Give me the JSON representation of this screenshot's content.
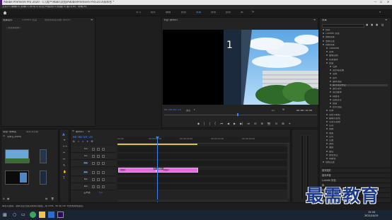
{
  "titlebar": {
    "title": "Adobe Premiere Pro 2020 - C:\\用户\\9bbs\\文档\\Adobe\\Premiere Pro\\14.0\\未命名 *",
    "min": "—",
    "max": "☐",
    "close": "✕"
  },
  "menus": [
    "文件(F)",
    "编辑(E)",
    "剪辑(C)",
    "序列(S)",
    "标记(M)",
    "图形(G)",
    "视图(V)",
    "窗口(W)",
    "帮助(H)"
  ],
  "workspaces": [
    "学习",
    "组件",
    "编辑",
    "颜色",
    "效果",
    "音频",
    "图形",
    "库"
  ],
  "active_workspace": "效果",
  "effect_controls": {
    "tabs": [
      "效果控件",
      "Lumetri 范围",
      "音频剪辑混合器: 序列01"
    ],
    "subtitle": "（ 未选择剪辑 ）"
  },
  "program": {
    "title": "节目: 序列01",
    "timecode_current": "00:00:04:24",
    "fit": "适合",
    "ratio": "1/2",
    "timecode_total": "00:00:10:00",
    "video_overlay_digit": "1",
    "transport": [
      "◆",
      "|",
      "|",
      "{",
      "⏮",
      "◀",
      "▶",
      "▶|",
      "⏭",
      "⊟",
      "⊞",
      "📷",
      "⊡",
      "⊠",
      "+"
    ]
  },
  "effects": {
    "tab": "效果",
    "items": [
      {
        "label": "预设",
        "level": 0
      },
      {
        "label": "Lumetri 预设",
        "level": 0
      },
      {
        "label": "音频效果",
        "level": 0
      },
      {
        "label": "音频过渡",
        "level": 0
      },
      {
        "label": "视频效果",
        "level": 0
      },
      {
        "label": "Obsolete",
        "level": 1
      },
      {
        "label": "变换",
        "level": 1
      },
      {
        "label": "图像控制",
        "level": 1
      },
      {
        "label": "实用程序",
        "level": 1
      },
      {
        "label": "扭曲",
        "level": 1
      },
      {
        "label": "位移",
        "level": 2
      },
      {
        "label": "变形稳定器",
        "level": 2
      },
      {
        "label": "变换",
        "level": 2
      },
      {
        "label": "放大",
        "level": 2
      },
      {
        "label": "旋转扭曲",
        "level": 2
      },
      {
        "label": "果冻效应修复",
        "level": 2,
        "selected": true
      },
      {
        "label": "波形变形",
        "level": 2
      },
      {
        "label": "湍流置换",
        "level": 2
      },
      {
        "label": "球面化",
        "level": 2
      },
      {
        "label": "边角定位",
        "level": 2
      },
      {
        "label": "镜像",
        "level": 2
      },
      {
        "label": "镜头扭曲",
        "level": 2
      },
      {
        "label": "时间",
        "level": 1
      },
      {
        "label": "杂色与颗粒",
        "level": 1
      },
      {
        "label": "模糊与锐化",
        "level": 1
      },
      {
        "label": "沉浸式视频",
        "level": 1
      },
      {
        "label": "生成",
        "level": 1
      },
      {
        "label": "视频",
        "level": 1
      },
      {
        "label": "调整",
        "level": 1
      },
      {
        "label": "过时",
        "level": 1
      },
      {
        "label": "过渡",
        "level": 1
      },
      {
        "label": "透视",
        "level": 1
      },
      {
        "label": "通道",
        "level": 1
      },
      {
        "label": "键控",
        "level": 1
      },
      {
        "label": "颜色校正",
        "level": 1
      },
      {
        "label": "风格化",
        "level": 1
      },
      {
        "label": "视频过渡",
        "level": 0
      }
    ],
    "sections": [
      "基本图形",
      "基本声音",
      "Lumetri 颜色",
      "库",
      "标记",
      "历史记录",
      "信息"
    ]
  },
  "project": {
    "tabs": [
      "项目: 未命名",
      "媒体浏览器"
    ],
    "filename": "未命名.prproj",
    "thumb_labels": [
      "",
      ""
    ]
  },
  "timeline": {
    "title": "序列01",
    "timecode": "00:00:04:24",
    "ruler": [
      "00:00",
      "00:00:05:00",
      "00:00:10:00",
      "00:00:15:00",
      "00:00:20:00"
    ],
    "tracks": [
      {
        "name": "V3",
        "kind": "video"
      },
      {
        "name": "V2",
        "kind": "video"
      },
      {
        "name": "V1",
        "kind": "video"
      },
      {
        "name": "A1",
        "kind": "audio"
      },
      {
        "name": "A2",
        "kind": "audio"
      },
      {
        "name": "A3",
        "kind": "audio"
      }
    ],
    "master": "主声道",
    "master_val": "0.0",
    "clips": [
      {
        "label": "视频1"
      },
      {
        "label": "视频2"
      }
    ],
    "clip_fx": "fx 视频2"
  },
  "status": {
    "text": "单击以选择，或单击空白处并拖动以框选。用 Shift、Alt 和 Ctrl 可获得其他选项。"
  },
  "taskbar": {
    "time": "15:34",
    "date": "2021/10/15"
  },
  "watermark": "最需教育",
  "colors": {
    "accent": "#3b82f6",
    "clip": "#e070dc",
    "playhead": "#3b82f6"
  }
}
